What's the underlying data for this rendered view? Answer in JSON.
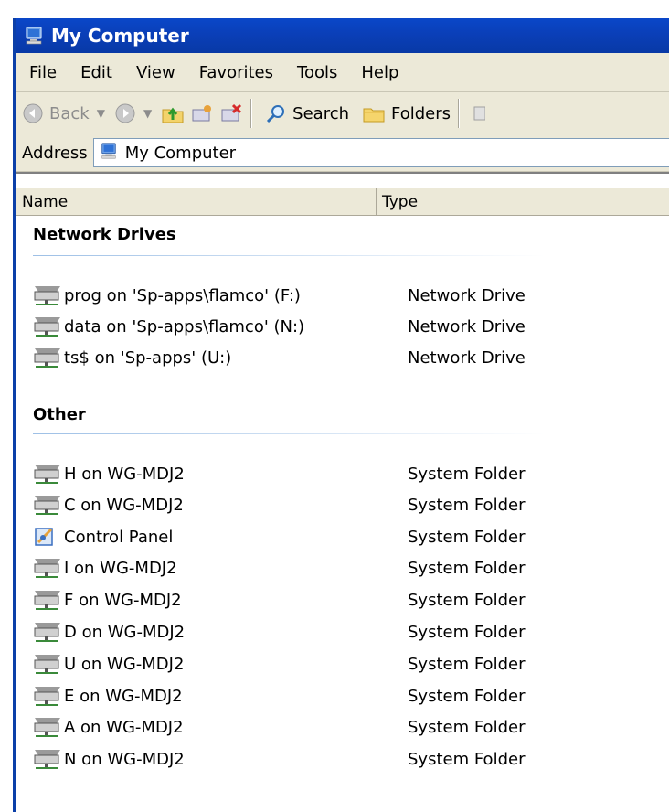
{
  "window": {
    "title": "My Computer"
  },
  "menu": [
    "File",
    "Edit",
    "View",
    "Favorites",
    "Tools",
    "Help"
  ],
  "toolbar": {
    "back": "Back",
    "search": "Search",
    "folders": "Folders"
  },
  "address": {
    "label": "Address",
    "value": "My Computer"
  },
  "columns": {
    "name": "Name",
    "type": "Type"
  },
  "groups": [
    {
      "title": "Network Drives",
      "items": [
        {
          "name": "prog on 'Sp-apps\\flamco' (F:)",
          "type": "Network Drive",
          "icon": "network-drive-icon"
        },
        {
          "name": "data on 'Sp-apps\\flamco' (N:)",
          "type": "Network Drive",
          "icon": "network-drive-icon"
        },
        {
          "name": "ts$ on 'Sp-apps' (U:)",
          "type": "Network Drive",
          "icon": "network-drive-icon"
        }
      ]
    },
    {
      "title": "Other",
      "items": [
        {
          "name": "H on WG-MDJ2",
          "type": "System Folder",
          "icon": "network-drive-icon"
        },
        {
          "name": "C on WG-MDJ2",
          "type": "System Folder",
          "icon": "network-drive-icon"
        },
        {
          "name": "Control Panel",
          "type": "System Folder",
          "icon": "control-panel-icon"
        },
        {
          "name": "I on WG-MDJ2",
          "type": "System Folder",
          "icon": "network-drive-icon"
        },
        {
          "name": "F on WG-MDJ2",
          "type": "System Folder",
          "icon": "network-drive-icon"
        },
        {
          "name": "D on WG-MDJ2",
          "type": "System Folder",
          "icon": "network-drive-icon"
        },
        {
          "name": "U on WG-MDJ2",
          "type": "System Folder",
          "icon": "network-drive-icon"
        },
        {
          "name": "E on WG-MDJ2",
          "type": "System Folder",
          "icon": "network-drive-icon"
        },
        {
          "name": "A on WG-MDJ2",
          "type": "System Folder",
          "icon": "network-drive-icon"
        },
        {
          "name": "N on WG-MDJ2",
          "type": "System Folder",
          "icon": "network-drive-icon"
        }
      ]
    }
  ],
  "colors": {
    "titlebar": "#0a47c9",
    "chrome": "#ece9d8",
    "groupLine": "#9ec0e6"
  }
}
